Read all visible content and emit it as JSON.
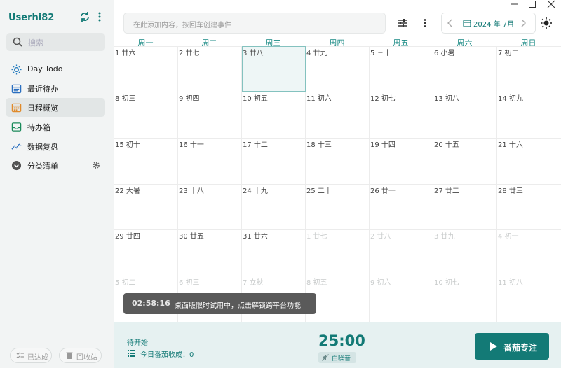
{
  "sidebar": {
    "username": "Userhi82",
    "search_placeholder": "搜索",
    "items": [
      {
        "label": "Day Todo",
        "icon": "sun-icon"
      },
      {
        "label": "最近待办",
        "icon": "calendar-list-icon"
      },
      {
        "label": "日程概览",
        "icon": "calendar-grid-icon",
        "active": true
      },
      {
        "label": "待办箱",
        "icon": "inbox-icon"
      },
      {
        "label": "数据复盘",
        "icon": "chart-line-icon"
      },
      {
        "label": "分类清单",
        "icon": "chevron-circle-icon"
      }
    ],
    "footer": {
      "completed_label": "已达成",
      "trash_label": "回收站"
    }
  },
  "topbar": {
    "add_placeholder": "在此添加内容，按回车创建事件",
    "month_label": "2024 年 7月"
  },
  "calendar": {
    "weekdays": [
      "周一",
      "周二",
      "周三",
      "周四",
      "周五",
      "周六",
      "周日"
    ],
    "weeks": [
      [
        {
          "d": "1 廿六"
        },
        {
          "d": "2 廿七"
        },
        {
          "d": "3 廿八",
          "today": true
        },
        {
          "d": "4 廿九"
        },
        {
          "d": "5 三十"
        },
        {
          "d": "6 小暑"
        },
        {
          "d": "7 初二"
        }
      ],
      [
        {
          "d": "8 初三"
        },
        {
          "d": "9 初四"
        },
        {
          "d": "10 初五"
        },
        {
          "d": "11 初六"
        },
        {
          "d": "12 初七"
        },
        {
          "d": "13 初八"
        },
        {
          "d": "14 初九"
        }
      ],
      [
        {
          "d": "15 初十"
        },
        {
          "d": "16 十一"
        },
        {
          "d": "17 十二"
        },
        {
          "d": "18 十三"
        },
        {
          "d": "19 十四"
        },
        {
          "d": "20 十五"
        },
        {
          "d": "21 十六"
        }
      ],
      [
        {
          "d": "22 大暑"
        },
        {
          "d": "23 十八"
        },
        {
          "d": "24 十九"
        },
        {
          "d": "25 二十"
        },
        {
          "d": "26 廿一"
        },
        {
          "d": "27 廿二"
        },
        {
          "d": "28 廿三"
        }
      ],
      [
        {
          "d": "29 廿四"
        },
        {
          "d": "30 廿五"
        },
        {
          "d": "31 廿六"
        },
        {
          "d": "1 廿七",
          "other": true
        },
        {
          "d": "2 廿八",
          "other": true
        },
        {
          "d": "3 廿九",
          "other": true
        },
        {
          "d": "4 初一",
          "other": true
        }
      ],
      [
        {
          "d": "5 初二",
          "other": true
        },
        {
          "d": "6 初三",
          "other": true
        },
        {
          "d": "7 立秋",
          "other": true
        },
        {
          "d": "8 初五",
          "other": true
        },
        {
          "d": "9 初六",
          "other": true
        },
        {
          "d": "10 初七",
          "other": true
        },
        {
          "d": "11 初八",
          "other": true
        }
      ]
    ]
  },
  "toast": {
    "time": "02:58:16",
    "message": "桌面版限时试用中，点击解锁跨平台功能"
  },
  "bottom": {
    "pending_label": "待开始",
    "today_count": "今日番茄收成：0",
    "timer": "25:00",
    "noise_label": "白噪音",
    "focus_label": "番茄专注"
  },
  "colors": {
    "accent": "#137a76",
    "sidebar_bg": "#f2f4f4",
    "bottom_bg": "#e6f1f1"
  }
}
